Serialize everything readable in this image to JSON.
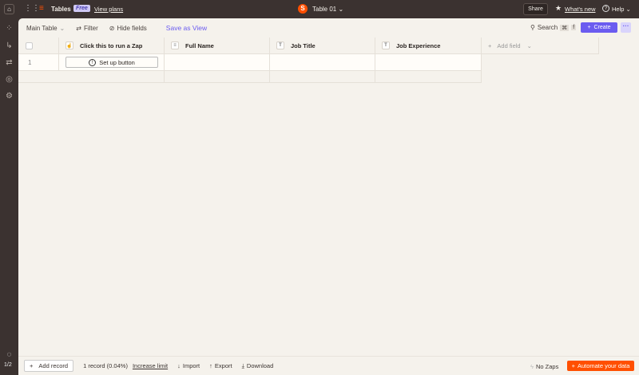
{
  "topbar": {
    "app_name": "Tables",
    "plan_badge": "Free",
    "view_plans": "View plans",
    "table_name": "Table 01",
    "share": "Share",
    "whats_new": "What's new",
    "help": "Help"
  },
  "sidebar": {
    "page_indicator": "1/2"
  },
  "toolbar": {
    "view_name": "Main Table",
    "filter": "Filter",
    "hide_fields": "Hide fields",
    "save_as_view": "Save as View",
    "search": "Search",
    "shortcut_cmd": "⌘",
    "shortcut_key": "f",
    "create": "Create"
  },
  "table": {
    "columns": [
      "Click this to run a Zap",
      "Full Name",
      "Job Title",
      "Job Experience"
    ],
    "column_type_icons": [
      "T",
      "≡",
      "T",
      "T"
    ],
    "add_field": "Add field",
    "rows": [
      {
        "index": "1",
        "button_label": "Set up button"
      }
    ]
  },
  "footer": {
    "add_record": "Add record",
    "record_count": "1 record (0.04%)",
    "increase_limit": "Increase limit",
    "import": "Import",
    "export": "Export",
    "download": "Download",
    "no_zaps": "No Zaps",
    "automate": "Automate your data"
  },
  "colors": {
    "accent": "#6b5cf0",
    "brand": "#ff4f00",
    "dark": "#3b3230"
  }
}
